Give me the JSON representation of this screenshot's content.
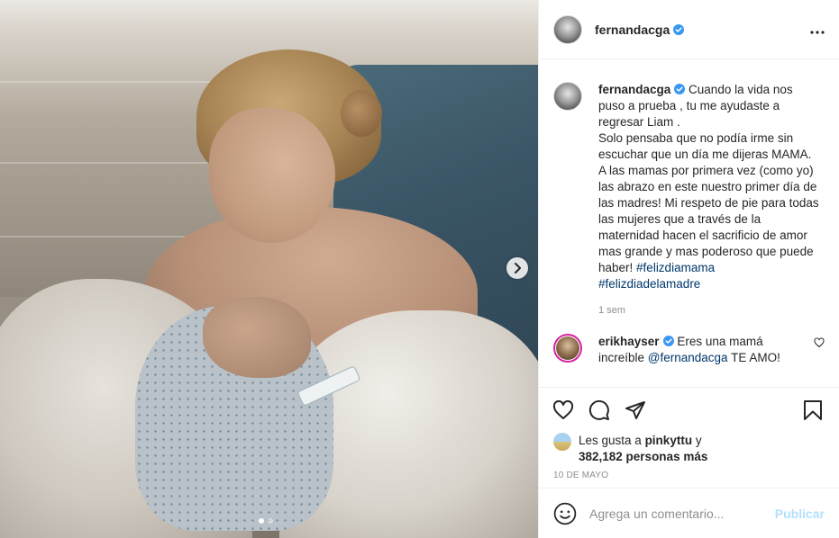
{
  "post": {
    "username": "fernandacga",
    "more_icon": "more-horizontal-icon",
    "carousel": {
      "next_icon": "chevron-right-icon",
      "slides_total": 2,
      "current_slide": 1
    }
  },
  "caption": {
    "username": "fernandacga",
    "paragraphs": [
      "Cuando la vida nos puso a prueba , tu me ayudaste a regresar Liam .",
      "Solo pensaba que no podía irme sin escuchar que un día me dijeras MAMA.",
      "A las mamas por primera vez (como yo) las abrazo en este nuestro primer día de las madres! Mi respeto de pie para todas las mujeres que a través de la maternidad hacen el sacrificio de amor mas grande y mas poderoso que puede haber!"
    ],
    "hashtag1": "#felizdiamama",
    "hashtag2": "#felizdiadelamadre",
    "time": "1 sem"
  },
  "comment": {
    "username": "erikhayser",
    "text": "Eres una mamá increíble",
    "mention": "@fernandacga",
    "text_after": " TE AMO!"
  },
  "actions": {
    "like_icon": "heart-icon",
    "comment_icon": "comment-icon",
    "share_icon": "share-icon",
    "save_icon": "bookmark-icon"
  },
  "likes": {
    "prefix": "Les gusta a ",
    "liker": "pinkyttu",
    "joiner": " y",
    "count": "382,182 personas más"
  },
  "date": "10 de mayo",
  "add_comment": {
    "emoji_icon": "emoji-icon",
    "placeholder": "Agrega un comentario...",
    "publish_label": "Publicar"
  },
  "colors": {
    "verified": "#3897f0",
    "link": "#00376b",
    "publish_disabled": "#b2dffc",
    "story_ring": "#d6249f"
  }
}
